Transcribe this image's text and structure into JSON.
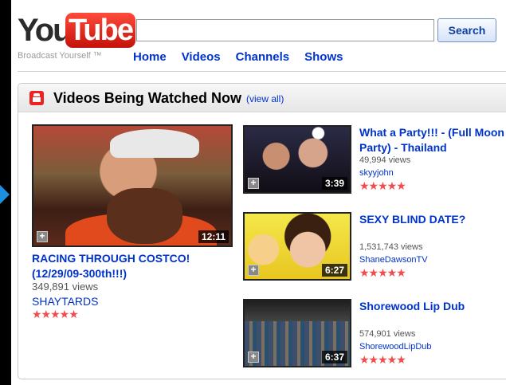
{
  "header": {
    "logo_you": "You",
    "logo_tube": "Tube",
    "tagline": "Broadcast Yourself ™",
    "search_value": "",
    "search_button": "Search",
    "nav": [
      "Home",
      "Videos",
      "Channels",
      "Shows"
    ]
  },
  "module": {
    "title": "Videos Being Watched Now",
    "view_all": "(view all)",
    "icon": "popcorn-icon"
  },
  "featured": {
    "title": "RACING THROUGH COSTCO! (12/29/09-300th!!!)",
    "views": "349,891 views",
    "user": "SHAYTARDS",
    "duration": "12:11",
    "rating": 5
  },
  "side_videos": [
    {
      "title": "What a Party!!! - (Full Moon Party) - Thailand",
      "views": "49,994 views",
      "user": "skyyjohn",
      "duration": "3:39",
      "rating": 5
    },
    {
      "title": "SEXY BLIND DATE?",
      "views": "1,531,743 views",
      "user": "ShaneDawsonTV",
      "duration": "6:27",
      "rating": 5
    },
    {
      "title": "Shorewood Lip Dub",
      "views": "574,901 views",
      "user": "ShorewoodLipDub",
      "duration": "6:37",
      "rating": 5
    }
  ],
  "colors": {
    "link": "#0033cc",
    "star": "#f24c4c",
    "logo_red": "#e0170c"
  }
}
